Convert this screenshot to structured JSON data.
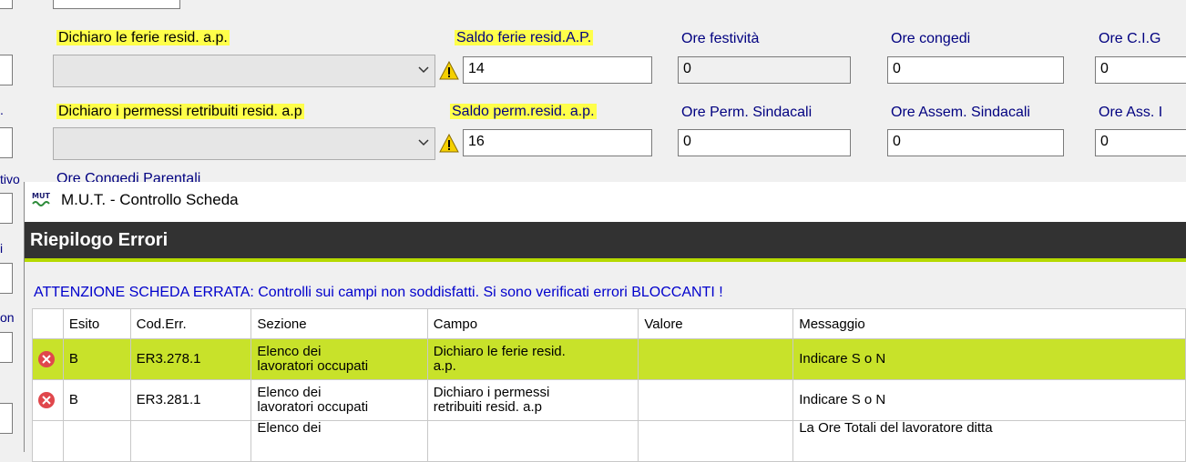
{
  "form": {
    "row1": {
      "dichiaro_label": "Dichiaro le ferie resid. a.p.",
      "saldo_label": "Saldo ferie resid.A.P.",
      "saldo_value": "14",
      "ore_festivita_label": "Ore festività",
      "ore_festivita_value": "0",
      "ore_congedi_label": "Ore congedi",
      "ore_congedi_value": "0",
      "ore_cig_label": "Ore C.I.G",
      "ore_cig_value": "0"
    },
    "row2": {
      "dichiaro_label": "Dichiaro i permessi retribuiti resid. a.p",
      "saldo_label": "Saldo perm.resid. a.p.",
      "saldo_value": "16",
      "ore_perm_sind_label": "Ore Perm. Sindacali",
      "ore_perm_sind_value": "0",
      "ore_assem_sind_label": "Ore Assem. Sindacali",
      "ore_assem_sind_value": "0",
      "ore_ass_label": "Ore Ass. I",
      "ore_ass_value": "0"
    },
    "partial_label": "Ore Congedi Parentali",
    "left_partial": [
      ".",
      "tivo",
      "i",
      "on"
    ]
  },
  "dialog": {
    "title": "M.U.T. - Controllo Scheda",
    "icon_text": "MUT",
    "header": "Riepilogo Errori",
    "attention": "ATTENZIONE SCHEDA ERRATA: Controlli sui campi non soddisfatti. Si sono verificati errori BLOCCANTI !",
    "columns": [
      "Esito",
      "Cod.Err.",
      "Sezione",
      "Campo",
      "Valore",
      "Messaggio"
    ],
    "rows": [
      {
        "esito": "B",
        "cod": "ER3.278.1",
        "sezione_1": "Elenco dei",
        "sezione_2": "lavoratori occupati",
        "campo_1": "Dichiaro le ferie resid.",
        "campo_2": "a.p.",
        "valore": "",
        "messaggio": "Indicare S o N"
      },
      {
        "esito": "B",
        "cod": "ER3.281.1",
        "sezione_1": "Elenco dei",
        "sezione_2": "lavoratori occupati",
        "campo_1": "Dichiaro i permessi",
        "campo_2": "retribuiti resid. a.p",
        "valore": "",
        "messaggio": "Indicare S o N"
      }
    ],
    "partial_row": {
      "sezione": "Elenco dei",
      "messaggio": "La Ore Totali del lavoratore ditta"
    }
  },
  "colors": {
    "label_blue": "#000080",
    "highlight_yellow": "#ffff4a",
    "selected_row": "#c8e22a",
    "dark_header": "#323232",
    "error_red": "#e0474c",
    "attention_blue": "#0000cc"
  }
}
